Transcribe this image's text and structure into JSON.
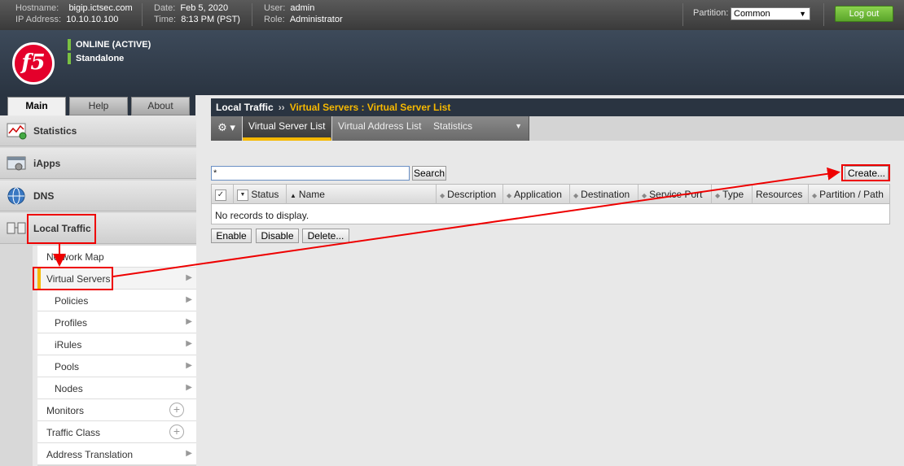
{
  "topbar": {
    "hostname_label": "Hostname:",
    "hostname": "bigip.ictsec.com",
    "ip_label": "IP Address:",
    "ip": "10.10.10.100",
    "date_label": "Date:",
    "date": "Feb 5, 2020",
    "time_label": "Time:",
    "time": "8:13 PM (PST)",
    "user_label": "User:",
    "user": "admin",
    "role_label": "Role:",
    "role": "Administrator",
    "partition_label": "Partition:",
    "partition_value": "Common",
    "logout_label": "Log out"
  },
  "header": {
    "logo_text": "f5",
    "status_1": "ONLINE (ACTIVE)",
    "status_2": "Standalone"
  },
  "left_tabs": [
    {
      "label": "Main",
      "active": true
    },
    {
      "label": "Help",
      "active": false
    },
    {
      "label": "About",
      "active": false
    }
  ],
  "nav": {
    "sections": [
      {
        "label": "Statistics",
        "icon": "statistics-icon"
      },
      {
        "label": "iApps",
        "icon": "iapps-icon"
      },
      {
        "label": "DNS",
        "icon": "globe-icon"
      },
      {
        "label": "Local Traffic",
        "icon": "local-traffic-icon"
      }
    ],
    "subitems": [
      {
        "label": "Network Map"
      },
      {
        "label": "Virtual Servers"
      },
      {
        "label": "Policies"
      },
      {
        "label": "Profiles"
      },
      {
        "label": "iRules"
      },
      {
        "label": "Pools"
      },
      {
        "label": "Nodes"
      },
      {
        "label": "Monitors"
      },
      {
        "label": "Traffic Class"
      },
      {
        "label": "Address Translation"
      }
    ]
  },
  "main": {
    "breadcrumb_root": "Local Traffic",
    "breadcrumb_sep": "››",
    "breadcrumb_current": "Virtual Servers : Virtual Server List",
    "tabs": [
      {
        "label": "Virtual Server List"
      },
      {
        "label": "Virtual Address List"
      },
      {
        "label": "Statistics"
      }
    ],
    "search_value": "*",
    "search_button": "Search",
    "create_button": "Create...",
    "columns": [
      "Status",
      "Name",
      "Description",
      "Application",
      "Destination",
      "Service Port",
      "Type",
      "Resources",
      "Partition / Path"
    ],
    "no_records": "No records to display.",
    "actions": [
      "Enable",
      "Disable",
      "Delete..."
    ]
  },
  "colors": {
    "accent": "#f6b800",
    "annotation": "#e00000",
    "logout_green": "#5aa52a",
    "header_dark": "#2a3441"
  }
}
